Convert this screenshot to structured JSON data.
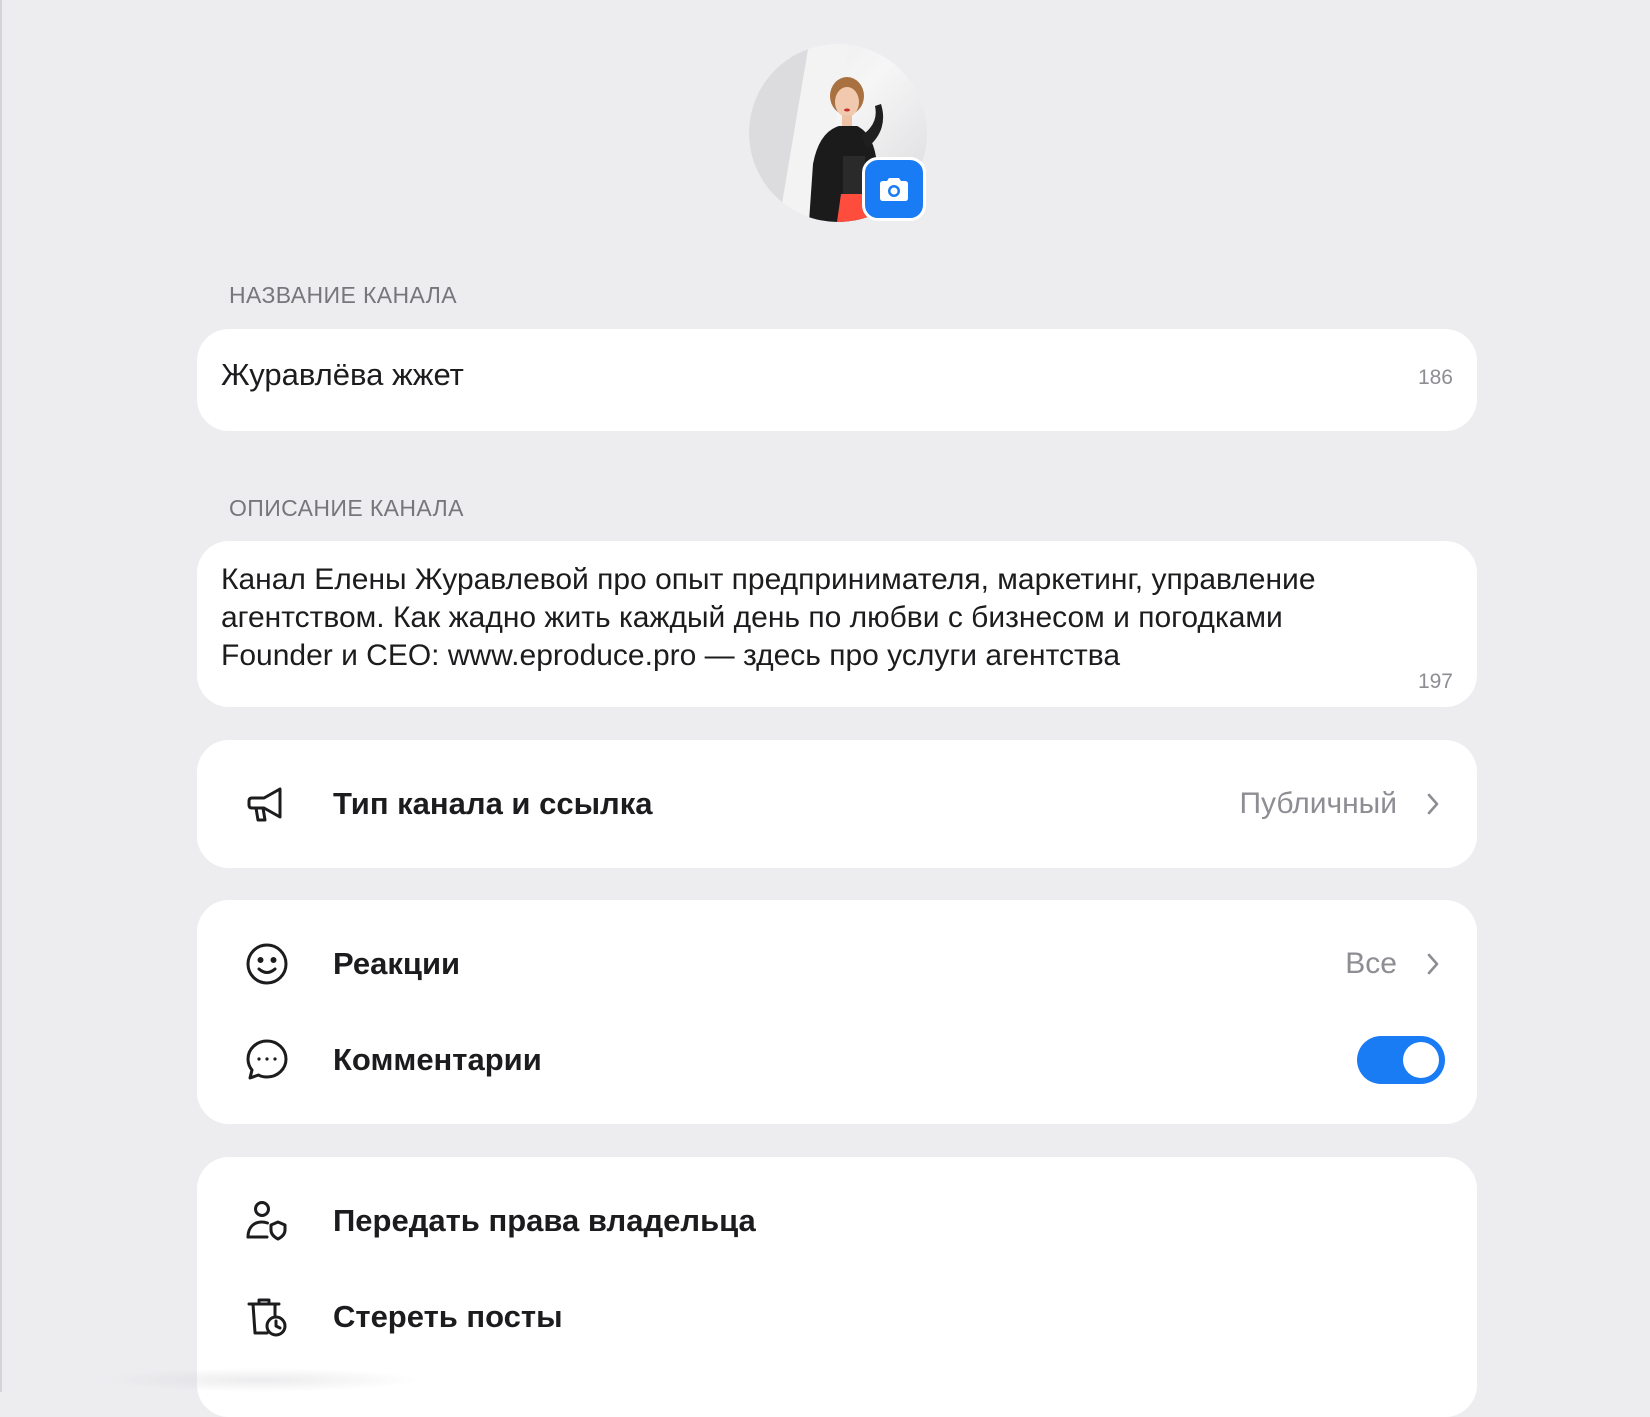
{
  "channel": {
    "name_label": "НАЗВАНИЕ КАНАЛА",
    "name_value": "Журавлёва жжет",
    "name_counter": "186",
    "description_label": "ОПИСАНИЕ КАНАЛА",
    "description_value": "Канал Елены Журавлевой про опыт предпринимателя, маркетинг, управление\nагентством. Как жадно жить каждый день по любви с бизнесом и погодками\nFounder и CEO: www.eproduce.pro — здесь про услуги агентства",
    "description_counter": "197"
  },
  "settings": {
    "type": {
      "label": "Тип канала и ссылка",
      "value": "Публичный",
      "icon": "megaphone-icon"
    },
    "reactions": {
      "label": "Реакции",
      "value": "Все",
      "icon": "smile-icon"
    },
    "comments": {
      "label": "Комментарии",
      "enabled": true,
      "icon": "comment-icon"
    },
    "transfer_owner": {
      "label": "Передать права владельца",
      "icon": "user-shield-icon"
    },
    "clear_posts": {
      "label": "Стереть посты",
      "icon": "trash-clock-icon"
    }
  },
  "colors": {
    "accent": "#1a7cf5",
    "background": "#ededf0",
    "card": "#ffffff",
    "secondary_text": "#8d8d93"
  }
}
